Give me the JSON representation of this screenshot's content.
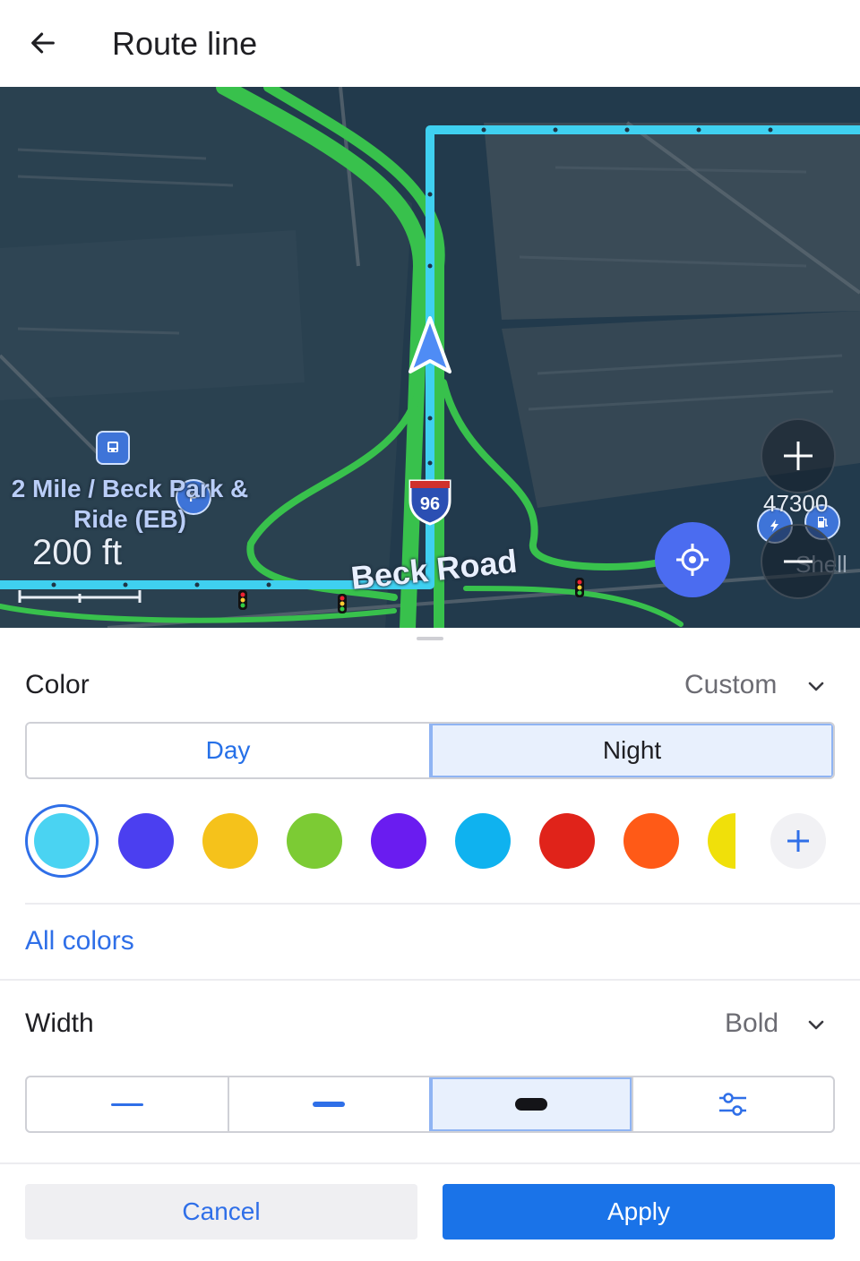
{
  "header": {
    "title": "Route line",
    "back_icon": "arrow-left-icon"
  },
  "map": {
    "poi_name": "2 Mile / Beck Park & Ride (EB)",
    "scale_label": "200 ft",
    "road_name": "Beck Road",
    "highway_shield": "96",
    "poi_number": "47300",
    "shell_label": "Shell",
    "zoom_in_icon": "plus-icon",
    "zoom_out_icon": "minus-icon",
    "locate_icon": "crosshair-icon",
    "route_color": "#3fd0f0",
    "road_color": "#35c04a"
  },
  "color_section": {
    "label": "Color",
    "value": "Custom",
    "mode_tabs": [
      {
        "label": "Day",
        "selected": false
      },
      {
        "label": "Night",
        "selected": true
      }
    ],
    "swatches": [
      "#4ad3f2",
      "#4b3ff0",
      "#f5c21b",
      "#7ccb34",
      "#6a1cf0",
      "#0fb2ef",
      "#e0231a",
      "#ff5a17",
      "#f0e00a"
    ],
    "selected_swatch": 0,
    "add_icon": "plus-icon",
    "all_colors_link": "All colors"
  },
  "width_section": {
    "label": "Width",
    "value": "Bold",
    "options": [
      "thin",
      "medium",
      "bold",
      "custom"
    ],
    "selected_index": 2,
    "custom_icon": "sliders-icon"
  },
  "footer": {
    "cancel_label": "Cancel",
    "apply_label": "Apply"
  }
}
